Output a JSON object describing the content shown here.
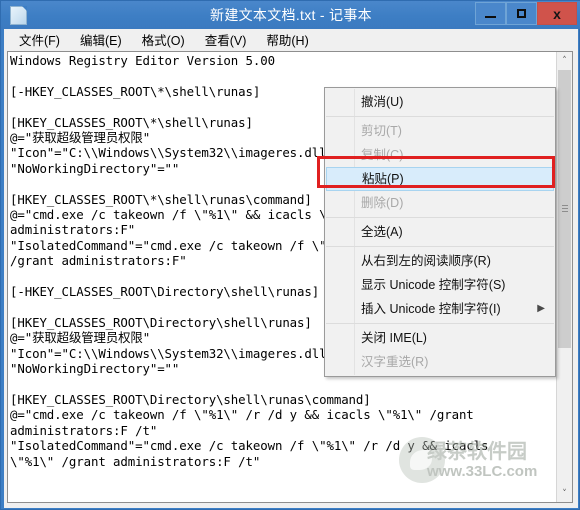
{
  "window": {
    "title": "新建文本文档.txt - 记事本",
    "icon": "notepad-document-icon",
    "controls": {
      "minimize_label": "",
      "maximize_label": "",
      "close_label": "x"
    },
    "accent_color": "#3d7ec4",
    "close_color": "#d0534b"
  },
  "menubar": {
    "items": [
      {
        "label": "文件(F)"
      },
      {
        "label": "编辑(E)"
      },
      {
        "label": "格式(O)"
      },
      {
        "label": "查看(V)"
      },
      {
        "label": "帮助(H)"
      }
    ]
  },
  "editor": {
    "content": "Windows Registry Editor Version 5.00\n\n[-HKEY_CLASSES_ROOT\\*\\shell\\runas]\n\n[HKEY_CLASSES_ROOT\\*\\shell\\runas]\n@=\"获取超级管理员权限\"\n\"Icon\"=\"C:\\\\Windows\\\\System32\\\\imageres.dll,-78\"\n\"NoWorkingDirectory\"=\"\"\n\n[HKEY_CLASSES_ROOT\\*\\shell\\runas\\command]\n@=\"cmd.exe /c takeown /f \\\"%1\\\" && icacls \\\"%1\\\" /grant\nadministrators:F\"\n\"IsolatedCommand\"=\"cmd.exe /c takeown /f \\\"%1\\\" && icacls \\\"%1\\\"\n/grant administrators:F\"\n\n[-HKEY_CLASSES_ROOT\\Directory\\shell\\runas]\n\n[HKEY_CLASSES_ROOT\\Directory\\shell\\runas]\n@=\"获取超级管理员权限\"\n\"Icon\"=\"C:\\\\Windows\\\\System32\\\\imageres.dll,-78\"\n\"NoWorkingDirectory\"=\"\"\n\n[HKEY_CLASSES_ROOT\\Directory\\shell\\runas\\command]\n@=\"cmd.exe /c takeown /f \\\"%1\\\" /r /d y && icacls \\\"%1\\\" /grant\nadministrators:F /t\"\n\"IsolatedCommand\"=\"cmd.exe /c takeown /f \\\"%1\\\" /r /d y && icacls\n\\\"%1\\\" /grant administrators:F /t\""
  },
  "scrollbar": {
    "up_arrow": "˄",
    "down_arrow": "˅"
  },
  "context_menu": {
    "items": [
      {
        "label": "撤消(U)",
        "state": "enabled",
        "submenu": false
      },
      {
        "label": "剪切(T)",
        "state": "disabled",
        "submenu": false
      },
      {
        "label": "复制(C)",
        "state": "disabled",
        "submenu": false
      },
      {
        "label": "粘贴(P)",
        "state": "selected",
        "submenu": false
      },
      {
        "label": "删除(D)",
        "state": "disabled",
        "submenu": false
      },
      {
        "label": "全选(A)",
        "state": "enabled",
        "submenu": false
      },
      {
        "label": "从右到左的阅读顺序(R)",
        "state": "enabled",
        "submenu": false
      },
      {
        "label": "显示 Unicode 控制字符(S)",
        "state": "enabled",
        "submenu": false
      },
      {
        "label": "插入 Unicode 控制字符(I)",
        "state": "enabled",
        "submenu": true
      },
      {
        "label": "关闭 IME(L)",
        "state": "enabled",
        "submenu": false
      },
      {
        "label": "汉字重选(R)",
        "state": "disabled",
        "submenu": false
      }
    ],
    "submenu_arrow": "▶"
  },
  "annotation": {
    "highlight_color": "#e02020",
    "target_label": "粘贴(P)"
  },
  "watermark": {
    "line1": "绿茶软件园",
    "line2": "www.33LC.com"
  }
}
